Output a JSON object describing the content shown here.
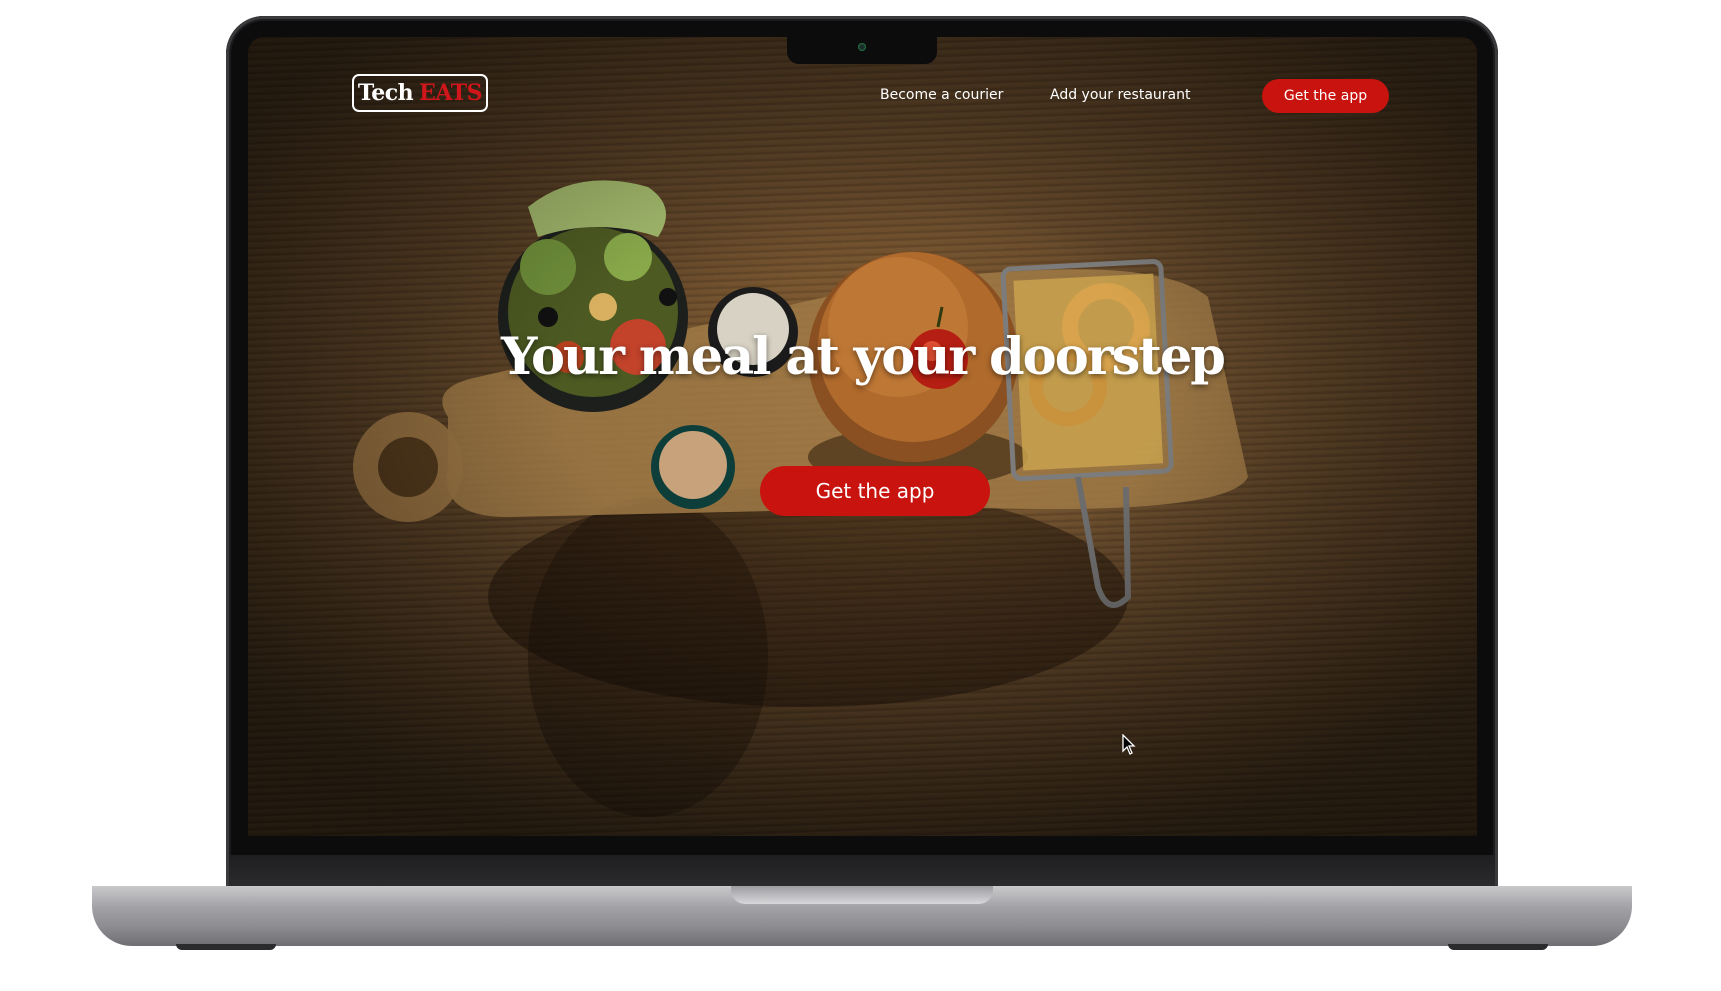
{
  "header": {
    "logo": {
      "part1": "Tech",
      "part2": "EATS"
    },
    "nav": {
      "courier_label": "Become a courier",
      "restaurant_label": "Add your restaurant",
      "cta_label": "Get the app"
    }
  },
  "hero": {
    "title": "Your meal at your doorstep",
    "cta_label": "Get the app"
  },
  "colors": {
    "brand_red": "#c8130f",
    "text_light": "#ffffff"
  },
  "icons": [
    "mouse-cursor-icon",
    "camera-icon"
  ]
}
